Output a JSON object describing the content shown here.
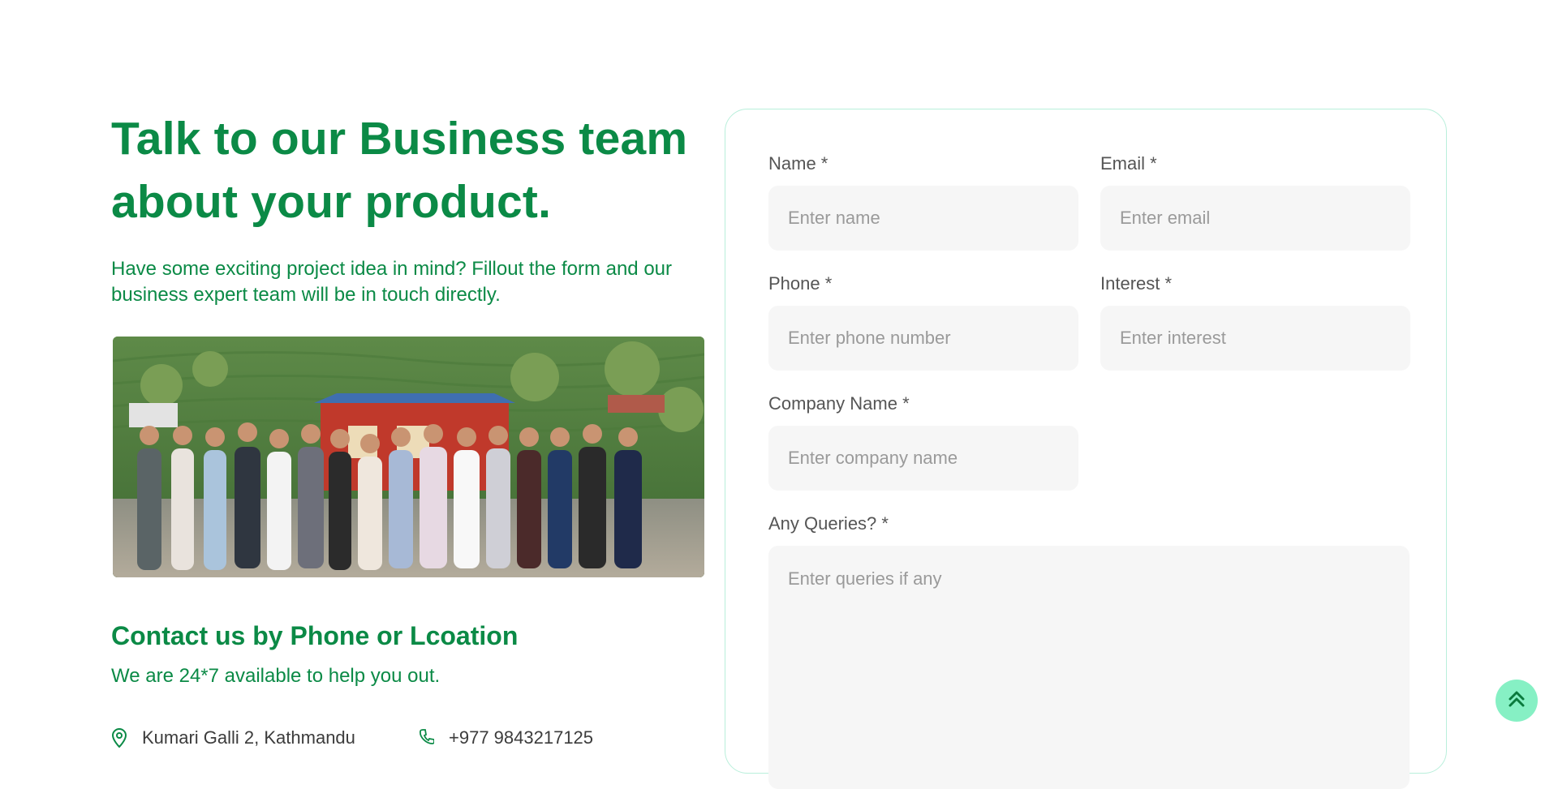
{
  "hero": {
    "headline_line1": "Talk to our Business team",
    "headline_line2": "about your product.",
    "subtext": "Have some exciting project idea in mind? Fillout the form and our business expert team will be in touch directly."
  },
  "photo": {
    "icon": "team-photo",
    "description_hidden": true
  },
  "contact": {
    "title": "Contact us by Phone or Lcoation",
    "subtitle": "We are 24*7 available to help you out.",
    "items": [
      {
        "icon": "location-pin-icon",
        "text": "Kumari Galli 2, Kathmandu"
      },
      {
        "icon": "phone-icon",
        "text": "+977 9843217125"
      }
    ]
  },
  "form": {
    "fields": {
      "name": {
        "label": "Name *",
        "placeholder": "Enter name"
      },
      "email": {
        "label": "Email *",
        "placeholder": "Enter email"
      },
      "phone": {
        "label": "Phone *",
        "placeholder": "Enter phone number"
      },
      "interest": {
        "label": "Interest *",
        "placeholder": "Enter interest"
      },
      "company": {
        "label": "Company Name *",
        "placeholder": "Enter company name"
      },
      "queries": {
        "label": "Any Queries? *",
        "placeholder": "Enter queries if any"
      }
    }
  },
  "scroll_top": {
    "icon": "double-chevron-up-icon"
  },
  "colors": {
    "brand_green": "#0b8a46",
    "field_bg": "#f6f6f6",
    "card_border": "#b9efdb",
    "scroll_button_bg": "#86f0c4"
  }
}
